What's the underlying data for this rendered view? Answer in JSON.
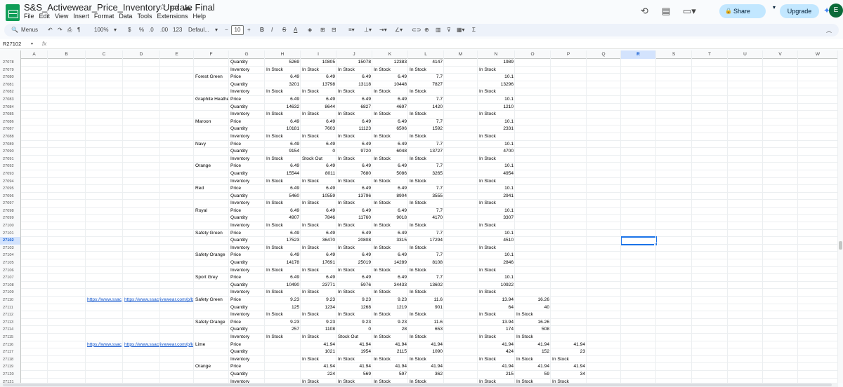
{
  "title": "S&S_Activewear_Price_Inventory Update Final",
  "menu": [
    "File",
    "Edit",
    "View",
    "Insert",
    "Format",
    "Data",
    "Tools",
    "Extensions",
    "Help"
  ],
  "header_right": {
    "share": "Share",
    "upgrade": "Upgrade",
    "avatar": "E"
  },
  "toolbar": {
    "menus": "Menus",
    "zoom": "100%",
    "currency": "$",
    "percent": "%",
    "dec_dec": ".0",
    "dec_inc": ".00",
    "num_format": "123",
    "font": "Defaul...",
    "font_size": "10",
    "minus": "−",
    "plus": "+",
    "bold": "B",
    "italic": "I",
    "strike": "S",
    "text_color": "A"
  },
  "formula_bar": {
    "name_box": "R27102",
    "fx": "fx",
    "value": ""
  },
  "columns": [
    "A",
    "B",
    "C",
    "D",
    "E",
    "F",
    "G",
    "H",
    "I",
    "J",
    "K",
    "L",
    "M",
    "N",
    "O",
    "P",
    "Q",
    "R",
    "S",
    "T",
    "U",
    "V",
    "W"
  ],
  "selected_col": "R",
  "selected_row": "27102",
  "rows": [
    {
      "n": "27078",
      "c": {
        "G": "Quantity",
        "H": "5269",
        "I": "10805",
        "J": "15078",
        "K": "12383",
        "L": "4147",
        "N": "1989"
      }
    },
    {
      "n": "27079",
      "c": {
        "G": "Inventory",
        "H": "In Stock",
        "I": "In Stock",
        "J": "In Stock",
        "K": "In Stock",
        "L": "In Stock",
        "N": "In Stock"
      }
    },
    {
      "n": "27080",
      "c": {
        "F": "Forest Green",
        "G": "Price",
        "H": "6.49",
        "I": "6.49",
        "J": "6.49",
        "K": "6.49",
        "L": "7.7",
        "N": "10.1"
      }
    },
    {
      "n": "27081",
      "c": {
        "G": "Quantity",
        "H": "3201",
        "I": "13798",
        "J": "13118",
        "K": "10448",
        "L": "7827",
        "N": "13296"
      }
    },
    {
      "n": "27082",
      "c": {
        "G": "Inventory",
        "H": "In Stock",
        "I": "In Stock",
        "J": "In Stock",
        "K": "In Stock",
        "L": "In Stock",
        "N": "In Stock"
      }
    },
    {
      "n": "27083",
      "c": {
        "F": "Graphite Heathe",
        "G": "Price",
        "H": "6.49",
        "I": "6.49",
        "J": "6.49",
        "K": "6.49",
        "L": "7.7",
        "N": "10.1"
      }
    },
    {
      "n": "27084",
      "c": {
        "G": "Quantity",
        "H": "14632",
        "I": "8644",
        "J": "6827",
        "K": "4697",
        "L": "1420",
        "N": "1210"
      }
    },
    {
      "n": "27085",
      "c": {
        "G": "Inventory",
        "H": "In Stock",
        "I": "In Stock",
        "J": "In Stock",
        "K": "In Stock",
        "L": "In Stock",
        "N": "In Stock"
      }
    },
    {
      "n": "27086",
      "c": {
        "F": "Maroon",
        "G": "Price",
        "H": "6.49",
        "I": "6.49",
        "J": "6.49",
        "K": "6.49",
        "L": "7.7",
        "N": "10.1"
      }
    },
    {
      "n": "27087",
      "c": {
        "G": "Quantity",
        "H": "10181",
        "I": "7603",
        "J": "11123",
        "K": "6506",
        "L": "1592",
        "N": "2331"
      }
    },
    {
      "n": "27088",
      "c": {
        "G": "Inventory",
        "H": "In Stock",
        "I": "In Stock",
        "J": "In Stock",
        "K": "In Stock",
        "L": "In Stock",
        "N": "In Stock"
      }
    },
    {
      "n": "27089",
      "c": {
        "F": "Navy",
        "G": "Price",
        "H": "6.49",
        "I": "6.49",
        "J": "6.49",
        "K": "6.49",
        "L": "7.7",
        "N": "10.1"
      }
    },
    {
      "n": "27090",
      "c": {
        "G": "Quantity",
        "H": "9154",
        "I": "0",
        "J": "9720",
        "K": "6048",
        "L": "13727",
        "N": "4700"
      }
    },
    {
      "n": "27091",
      "c": {
        "G": "Inventory",
        "H": "In Stock",
        "I": "Stock Out",
        "J": "In Stock",
        "K": "In Stock",
        "L": "In Stock",
        "N": "In Stock"
      }
    },
    {
      "n": "27092",
      "c": {
        "F": "Orange",
        "G": "Price",
        "H": "6.49",
        "I": "6.49",
        "J": "6.49",
        "K": "6.49",
        "L": "7.7",
        "N": "10.1"
      }
    },
    {
      "n": "27093",
      "c": {
        "G": "Quantity",
        "H": "15544",
        "I": "8011",
        "J": "7680",
        "K": "5086",
        "L": "3265",
        "N": "4954"
      }
    },
    {
      "n": "27094",
      "c": {
        "G": "Inventory",
        "H": "In Stock",
        "I": "In Stock",
        "J": "In Stock",
        "K": "In Stock",
        "L": "In Stock",
        "N": "In Stock"
      }
    },
    {
      "n": "27095",
      "c": {
        "F": "Red",
        "G": "Price",
        "H": "6.49",
        "I": "6.49",
        "J": "6.49",
        "K": "6.49",
        "L": "7.7",
        "N": "10.1"
      }
    },
    {
      "n": "27096",
      "c": {
        "G": "Quantity",
        "H": "5460",
        "I": "10559",
        "J": "13796",
        "K": "8904",
        "L": "3555",
        "N": "2941"
      }
    },
    {
      "n": "27097",
      "c": {
        "G": "Inventory",
        "H": "In Stock",
        "I": "In Stock",
        "J": "In Stock",
        "K": "In Stock",
        "L": "In Stock",
        "N": "In Stock"
      }
    },
    {
      "n": "27098",
      "c": {
        "F": "Royal",
        "G": "Price",
        "H": "6.49",
        "I": "6.49",
        "J": "6.49",
        "K": "6.49",
        "L": "7.7",
        "N": "10.1"
      }
    },
    {
      "n": "27099",
      "c": {
        "G": "Quantity",
        "H": "4907",
        "I": "7846",
        "J": "11760",
        "K": "9018",
        "L": "4170",
        "N": "3307"
      }
    },
    {
      "n": "27100",
      "c": {
        "G": "Inventory",
        "H": "In Stock",
        "I": "In Stock",
        "J": "In Stock",
        "K": "In Stock",
        "L": "In Stock",
        "N": "In Stock"
      }
    },
    {
      "n": "27101",
      "c": {
        "F": "Safety Green",
        "G": "Price",
        "H": "6.49",
        "I": "6.49",
        "J": "6.49",
        "K": "6.49",
        "L": "7.7",
        "N": "10.1"
      }
    },
    {
      "n": "27102",
      "c": {
        "G": "Quantity",
        "H": "17523",
        "I": "36470",
        "J": "20808",
        "K": "3315",
        "L": "17294",
        "N": "4510"
      }
    },
    {
      "n": "27103",
      "c": {
        "G": "Inventory",
        "H": "In Stock",
        "I": "In Stock",
        "J": "In Stock",
        "K": "In Stock",
        "L": "In Stock",
        "N": "In Stock"
      }
    },
    {
      "n": "27104",
      "c": {
        "F": "Safety Orange",
        "G": "Price",
        "H": "6.49",
        "I": "6.49",
        "J": "6.49",
        "K": "6.49",
        "L": "7.7",
        "N": "10.1"
      }
    },
    {
      "n": "27105",
      "c": {
        "G": "Quantity",
        "H": "14178",
        "I": "17691",
        "J": "25019",
        "K": "14289",
        "L": "8108",
        "N": "2846"
      }
    },
    {
      "n": "27106",
      "c": {
        "G": "Inventory",
        "H": "In Stock",
        "I": "In Stock",
        "J": "In Stock",
        "K": "In Stock",
        "L": "In Stock",
        "N": "In Stock"
      }
    },
    {
      "n": "27107",
      "c": {
        "F": "Sport Grey",
        "G": "Price",
        "H": "6.49",
        "I": "6.49",
        "J": "6.49",
        "K": "6.49",
        "L": "7.7",
        "N": "10.1"
      }
    },
    {
      "n": "27108",
      "c": {
        "G": "Quantity",
        "H": "10490",
        "I": "23771",
        "J": "5976",
        "K": "34433",
        "L": "13602",
        "N": "10922"
      }
    },
    {
      "n": "27109",
      "c": {
        "G": "Inventory",
        "H": "In Stock",
        "I": "In Stock",
        "J": "In Stock",
        "K": "In Stock",
        "L": "In Stock",
        "N": "In Stock"
      }
    },
    {
      "n": "27110",
      "c": {
        "C": "https://www.ssac",
        "D": "https://www.ssactivewear.com/p/b",
        "F": "Safety Green",
        "G": "Price",
        "H": "9.23",
        "I": "9.23",
        "J": "9.23",
        "K": "9.23",
        "L": "11.6",
        "N": "13.94",
        "O": "16.26"
      }
    },
    {
      "n": "27111",
      "c": {
        "G": "Quantity",
        "H": "125",
        "I": "1234",
        "J": "1268",
        "K": "1219",
        "L": "901",
        "N": "64",
        "O": "40"
      }
    },
    {
      "n": "27112",
      "c": {
        "G": "Inventory",
        "H": "In Stock",
        "I": "In Stock",
        "J": "In Stock",
        "K": "In Stock",
        "L": "In Stock",
        "N": "In Stock",
        "O": "In Stock"
      }
    },
    {
      "n": "27113",
      "c": {
        "F": "Safety Orange",
        "G": "Price",
        "H": "9.23",
        "I": "9.23",
        "J": "9.23",
        "K": "9.23",
        "L": "11.6",
        "N": "13.94",
        "O": "16.26"
      }
    },
    {
      "n": "27114",
      "c": {
        "G": "Quantity",
        "H": "257",
        "I": "1108",
        "J": "0",
        "K": "28",
        "L": "653",
        "N": "174",
        "O": "508"
      }
    },
    {
      "n": "27115",
      "c": {
        "G": "Inventory",
        "H": "In Stock",
        "I": "In Stock",
        "J": "Stock Out",
        "K": "In Stock",
        "L": "In Stock",
        "N": "In Stock",
        "O": "In Stock"
      }
    },
    {
      "n": "27116",
      "c": {
        "C": "https://www.ssac",
        "D": "https://www.ssactivewear.com/p/k",
        "F": "Lime",
        "G": "Price",
        "I": "41.94",
        "J": "41.94",
        "K": "41.94",
        "L": "41.94",
        "N": "41.94",
        "O": "41.94",
        "P": "41.94"
      }
    },
    {
      "n": "27117",
      "c": {
        "G": "Quantity",
        "I": "1021",
        "J": "1954",
        "K": "2115",
        "L": "1090",
        "N": "424",
        "O": "152",
        "P": "23"
      }
    },
    {
      "n": "27118",
      "c": {
        "G": "Inventory",
        "I": "In Stock",
        "J": "In Stock",
        "K": "In Stock",
        "L": "In Stock",
        "N": "In Stock",
        "O": "In Stock",
        "P": "In Stock"
      }
    },
    {
      "n": "27119",
      "c": {
        "F": "Orange",
        "G": "Price",
        "I": "41.94",
        "J": "41.94",
        "K": "41.94",
        "L": "41.94",
        "N": "41.94",
        "O": "41.94",
        "P": "41.94"
      }
    },
    {
      "n": "27120",
      "c": {
        "G": "Quantity",
        "I": "224",
        "J": "569",
        "K": "597",
        "L": "362",
        "N": "215",
        "O": "59",
        "P": "34"
      }
    },
    {
      "n": "27121",
      "c": {
        "G": "Inventory",
        "I": "In Stock",
        "J": "In Stock",
        "K": "In Stock",
        "L": "In Stock",
        "N": "In Stock",
        "O": "In Stock",
        "P": "In Stock"
      }
    }
  ]
}
